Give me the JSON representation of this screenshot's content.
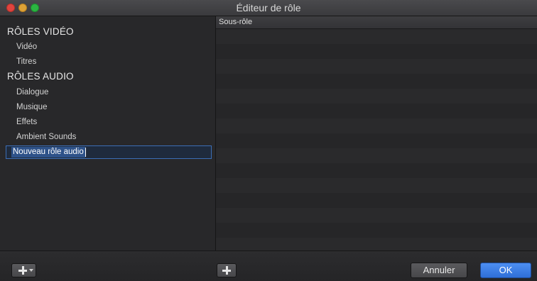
{
  "window": {
    "title": "Éditeur de rôle"
  },
  "sidebar": {
    "video_header": "RÔLES VIDÉO",
    "video_items": [
      "Vidéo",
      "Titres"
    ],
    "audio_header": "RÔLES AUDIO",
    "audio_items": [
      "Dialogue",
      "Musique",
      "Effets",
      "Ambient Sounds"
    ],
    "editing_item": "Nouveau rôle audio"
  },
  "table": {
    "column_header": "Sous-rôle"
  },
  "footer": {
    "add_menu_icon": "plus-icon",
    "add_subrole_icon": "plus-icon",
    "cancel_label": "Annuler",
    "ok_label": "OK"
  },
  "colors": {
    "accent": "#3b6db5",
    "ok_button": "#2f6fd8",
    "close_dot": "#e0443e",
    "minimize_dot": "#dea236",
    "zoom_dot": "#2bb541"
  }
}
